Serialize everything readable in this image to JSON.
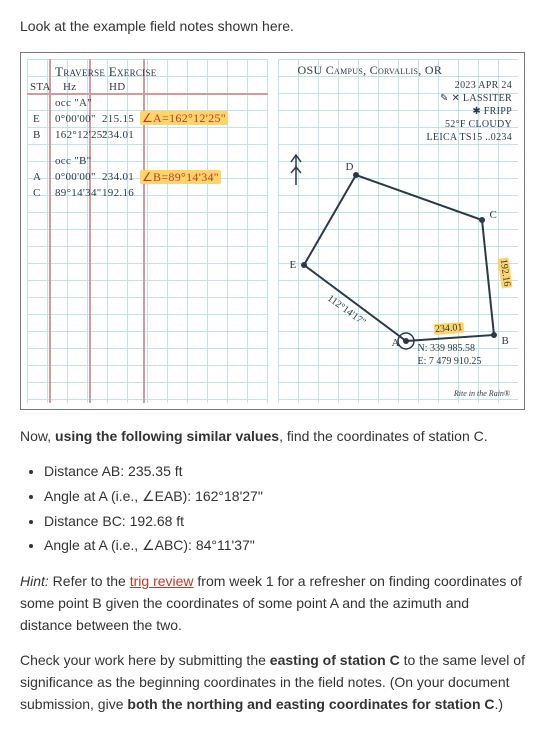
{
  "intro": "Look at the example field notes shown here.",
  "notes": {
    "left": {
      "title": "Traverse Exercise",
      "headers": {
        "sta": "STA",
        "hz": "Hz",
        "hd": "HD"
      },
      "occA_header": "occ \"A\"",
      "rows_A": [
        {
          "sta": "E",
          "hz": "0°00'00\"",
          "hd": "215.15"
        },
        {
          "sta": "B",
          "hz": "162°12'25\"",
          "hd": "234.01"
        }
      ],
      "ann_A": "∠A=162°12'25\"",
      "occB_header": "occ \"B\"",
      "rows_B": [
        {
          "sta": "A",
          "hz": "0°00'00\"",
          "hd": "234.01"
        },
        {
          "sta": "C",
          "hz": "89°14'34\"",
          "hd": "192.16"
        }
      ],
      "ann_B": "∠B=89°14'34\""
    },
    "right": {
      "title": "OSU Campus, Corvallis, OR",
      "meta": {
        "date": "2023 APR 24",
        "names": "✎ ✕ LASSITER",
        "fripp": "✱ FRIPP",
        "weather": "52°F CLOUDY",
        "inst": "LEICA TS15 ..0234"
      },
      "points": [
        "A",
        "B",
        "C",
        "D",
        "E"
      ],
      "lenBC": "192.16",
      "lenAB": "234.01",
      "bearEA": "112°14'17\"",
      "coordsA": {
        "n": "N: 339 985.58",
        "e": "E: 7 479 910.25"
      },
      "credit": "Rite in the Rain®"
    }
  },
  "transition_a": "Now, ",
  "transition_b": "using the following similar values",
  "transition_c": ", find the coordinates of station C.",
  "given": [
    "Distance AB: 235.35 ft",
    "Angle at A (i.e., ∠EAB): 162°18'27\"",
    "Distance BC: 192.68 ft",
    "Angle at A (i.e., ∠ABC): 84°11'37\""
  ],
  "hint": {
    "label": "Hint:",
    "pre": " Refer to the ",
    "link": "trig review",
    "post": " from week 1 for a refresher on finding coordinates of some point B given the coordinates of some point A and the azimuth and distance between the two."
  },
  "check_a": "Check your work here by submitting the ",
  "check_b": "easting of station C",
  "check_c": " to the same level of significance as the beginning coordinates in the field notes. (On your document submission, give ",
  "check_d": "both the northing and easting coordinates for station C",
  "check_e": ".)"
}
